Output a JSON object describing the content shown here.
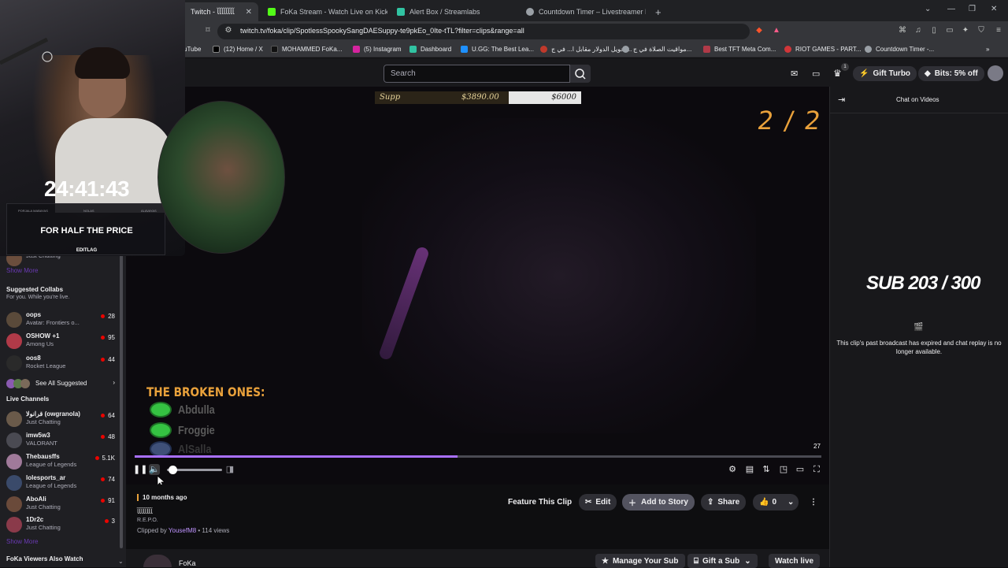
{
  "browser": {
    "tabs": [
      {
        "title": "Twitch - ﺂﺂﺂﺂﺂﺂﺂﺂ",
        "active": true
      },
      {
        "title": "FoKa Stream - Watch Live on Kick"
      },
      {
        "title": "Alert Box / Streamlabs"
      },
      {
        "title": "Countdown Timer – Livestreamer Hu"
      }
    ],
    "new_tab": "+",
    "url": "twitch.tv/foka/clip/SpotlessSpookySangDAESuppy-te9pkEo_0Ite-tTL?filter=clips&range=all",
    "bookmarks": [
      "uTube",
      "(12) Home / X",
      "MOHAMMED FoKa...",
      "(5) Instagram",
      "Dashboard",
      "U.GG: The Best Lea...",
      "تحويل الدولار مقابل ا... في ج...",
      "مواقيت الصلاة في ج...",
      "Best TFT Meta Com...",
      "RIOT GAMES - PART...",
      "Countdown Timer -..."
    ],
    "colors": {
      "twitch_purple": "#9147ff",
      "live_red": "#eb0400",
      "overlay_orange": "#e9a13b"
    }
  },
  "topnav": {
    "search_placeholder": "Search",
    "gift_turbo": "Gift Turbo",
    "bits": "Bits: 5% off",
    "notification_count": "1"
  },
  "sidebar": {
    "partial_channel_game": "Just Chatting",
    "show_more_1": "Show More",
    "suggested_collabs": {
      "title": "Suggested Collabs",
      "subtitle": "For you. While you're live.",
      "items": [
        {
          "name": "oops",
          "game": "Avatar: Frontiers o...",
          "viewers": "28"
        },
        {
          "name": "OSHOW +1",
          "game": "Among Us",
          "viewers": "95"
        },
        {
          "name": "oos8",
          "game": "Rocket League",
          "viewers": "44"
        }
      ],
      "see_all": "See All Suggested"
    },
    "live_channels": {
      "title": "Live Channels",
      "items": [
        {
          "name": "قرانولا (owgranola)",
          "game": "Just Chatting",
          "viewers": "64"
        },
        {
          "name": "imw5w3",
          "game": "VALORANT",
          "viewers": "48"
        },
        {
          "name": "Thebausffs",
          "game": "League of Legends",
          "viewers": "5.1K"
        },
        {
          "name": "lolesports_ar",
          "game": "League of Legends",
          "viewers": "74"
        },
        {
          "name": "AboAli",
          "game": "Just Chatting",
          "viewers": "91"
        },
        {
          "name": "1Dr2c",
          "game": "Just Chatting",
          "viewers": "3"
        }
      ]
    },
    "show_more_2": "Show More",
    "viewers_also_watch": "FoKa Viewers Also Watch"
  },
  "overlay": {
    "timer": "24:41:43",
    "promo_text": "FOR HALF THE PRICE",
    "promo_tiny": [
      "PORJALA MABAYAS",
      "NOLAS",
      "ALAVAYAS"
    ],
    "promo_brand": "EDITLAG",
    "goal": {
      "label": "Supp",
      "current": "$3890.00",
      "target": "$6000",
      "progress": 0.65
    },
    "counter": "2 / 2",
    "broken_title": "THE BROKEN ONES:",
    "broken_names": [
      "Abdulla",
      "Froggie",
      "AlSalla"
    ]
  },
  "player": {
    "time_remaining": "27",
    "progress": 0.47,
    "volume": 0.05
  },
  "clip": {
    "ago": "10 months ago",
    "title": "ﺂﺂﺂﺂﺂﺂﺂﺂ",
    "game": "R.E.P.O.",
    "clipped_by_prefix": "Clipped by ",
    "clipper": "YousefM8",
    "views": " • 114 views",
    "feature": "Feature This Clip",
    "edit": "Edit",
    "add_story": "Add to Story",
    "share": "Share",
    "likes": "0"
  },
  "bottom": {
    "channel": "FoKa",
    "manage_sub": "Manage Your Sub",
    "gift_sub": "Gift a Sub",
    "watch_live": "Watch live"
  },
  "chat": {
    "title": "Chat on Videos",
    "sub_count": "SUB 203 / 300",
    "message": "This clip's past broadcast has expired and chat replay is no longer available."
  }
}
